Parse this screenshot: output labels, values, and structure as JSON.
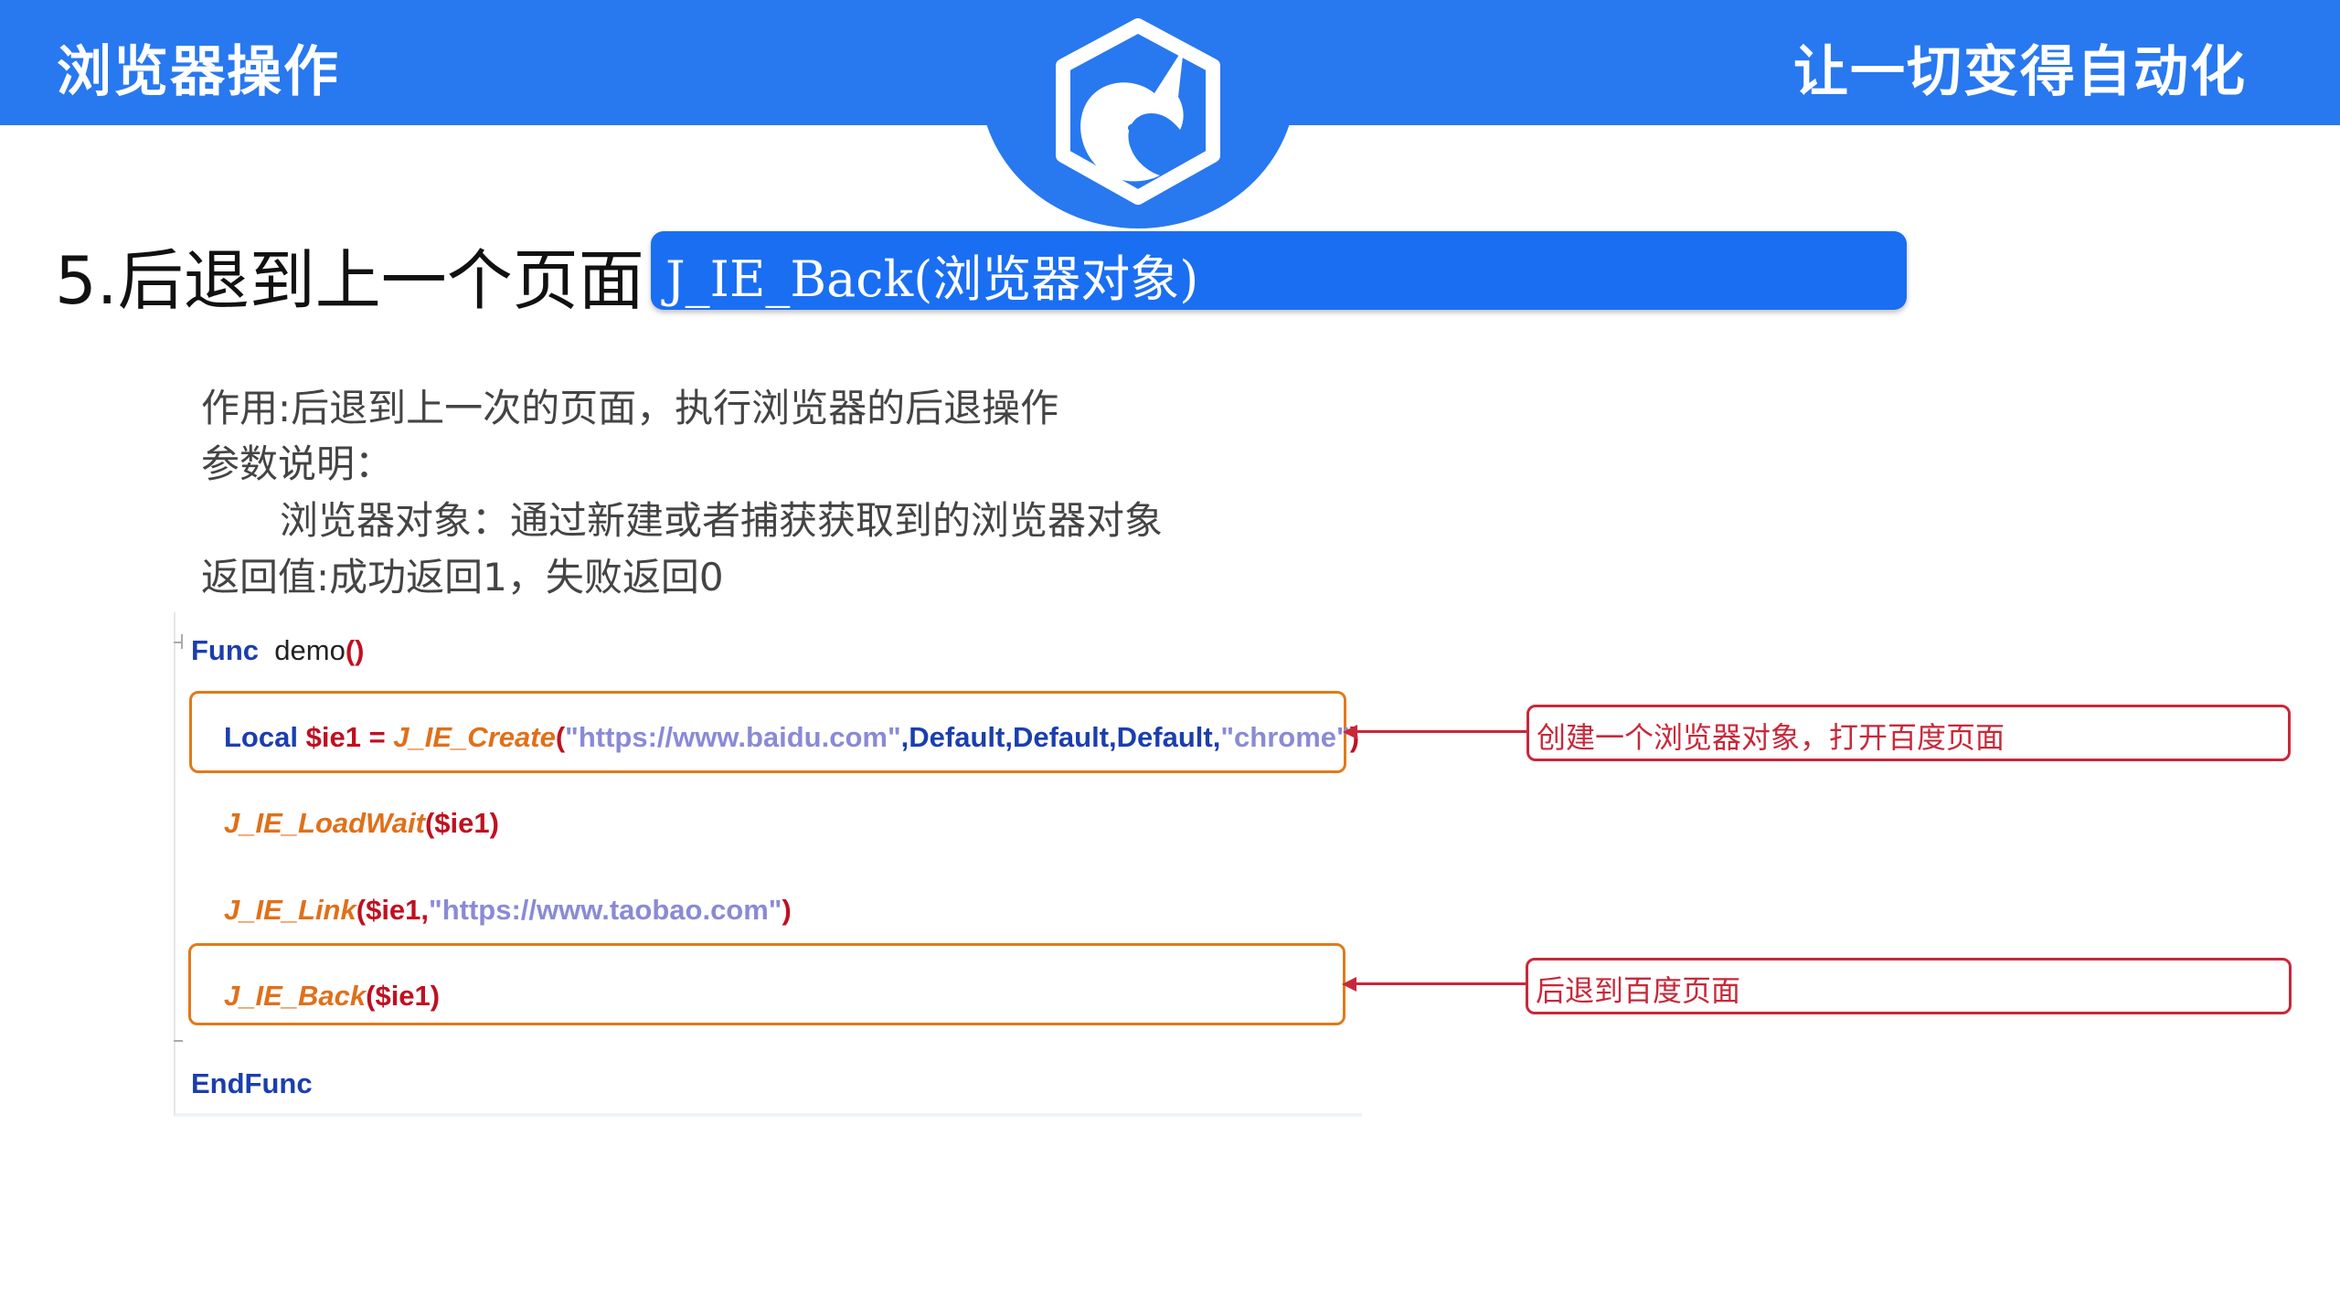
{
  "header": {
    "left_title": "浏览器操作",
    "right_title": "让一切变得自动化",
    "logo_icon": "unicorn-icon",
    "bg_color": "#2878f0"
  },
  "section": {
    "title": "5.后退到上一个页面",
    "signature": "J_IE_Back(浏览器对象)"
  },
  "description": {
    "purpose": "作用:后退到上一次的页面，执行浏览器的后退操作",
    "params_heading": "参数说明：",
    "param_1": "浏览器对象：通过新建或者捕获获取到的浏览器对象",
    "return_value": "返回值:成功返回1，失败返回0"
  },
  "code": {
    "line1": {
      "kw": "Func",
      "name": "demo",
      "parens": "()"
    },
    "line2": {
      "kw": "Local",
      "var": "$ie1",
      "eq": "=",
      "fn": "J_IE_Create",
      "open": "(",
      "url": "\"https://www.baidu.com\"",
      "args": ",Default,Default,Default,",
      "browser": "\"chrome\"",
      "close": ")"
    },
    "line3": {
      "fn": "J_IE_LoadWait",
      "args": "($ie1)"
    },
    "line4": {
      "fn": "J_IE_Link",
      "args": "($ie1,",
      "url": "\"https://www.taobao.com\"",
      "close": ")"
    },
    "line5": {
      "fn": "J_IE_Back",
      "args": "($ie1)"
    },
    "line6": {
      "kw": "EndFunc"
    }
  },
  "annotations": {
    "note_1": "创建一个浏览器对象，打开百度页面",
    "note_2": "后退到百度页面"
  }
}
